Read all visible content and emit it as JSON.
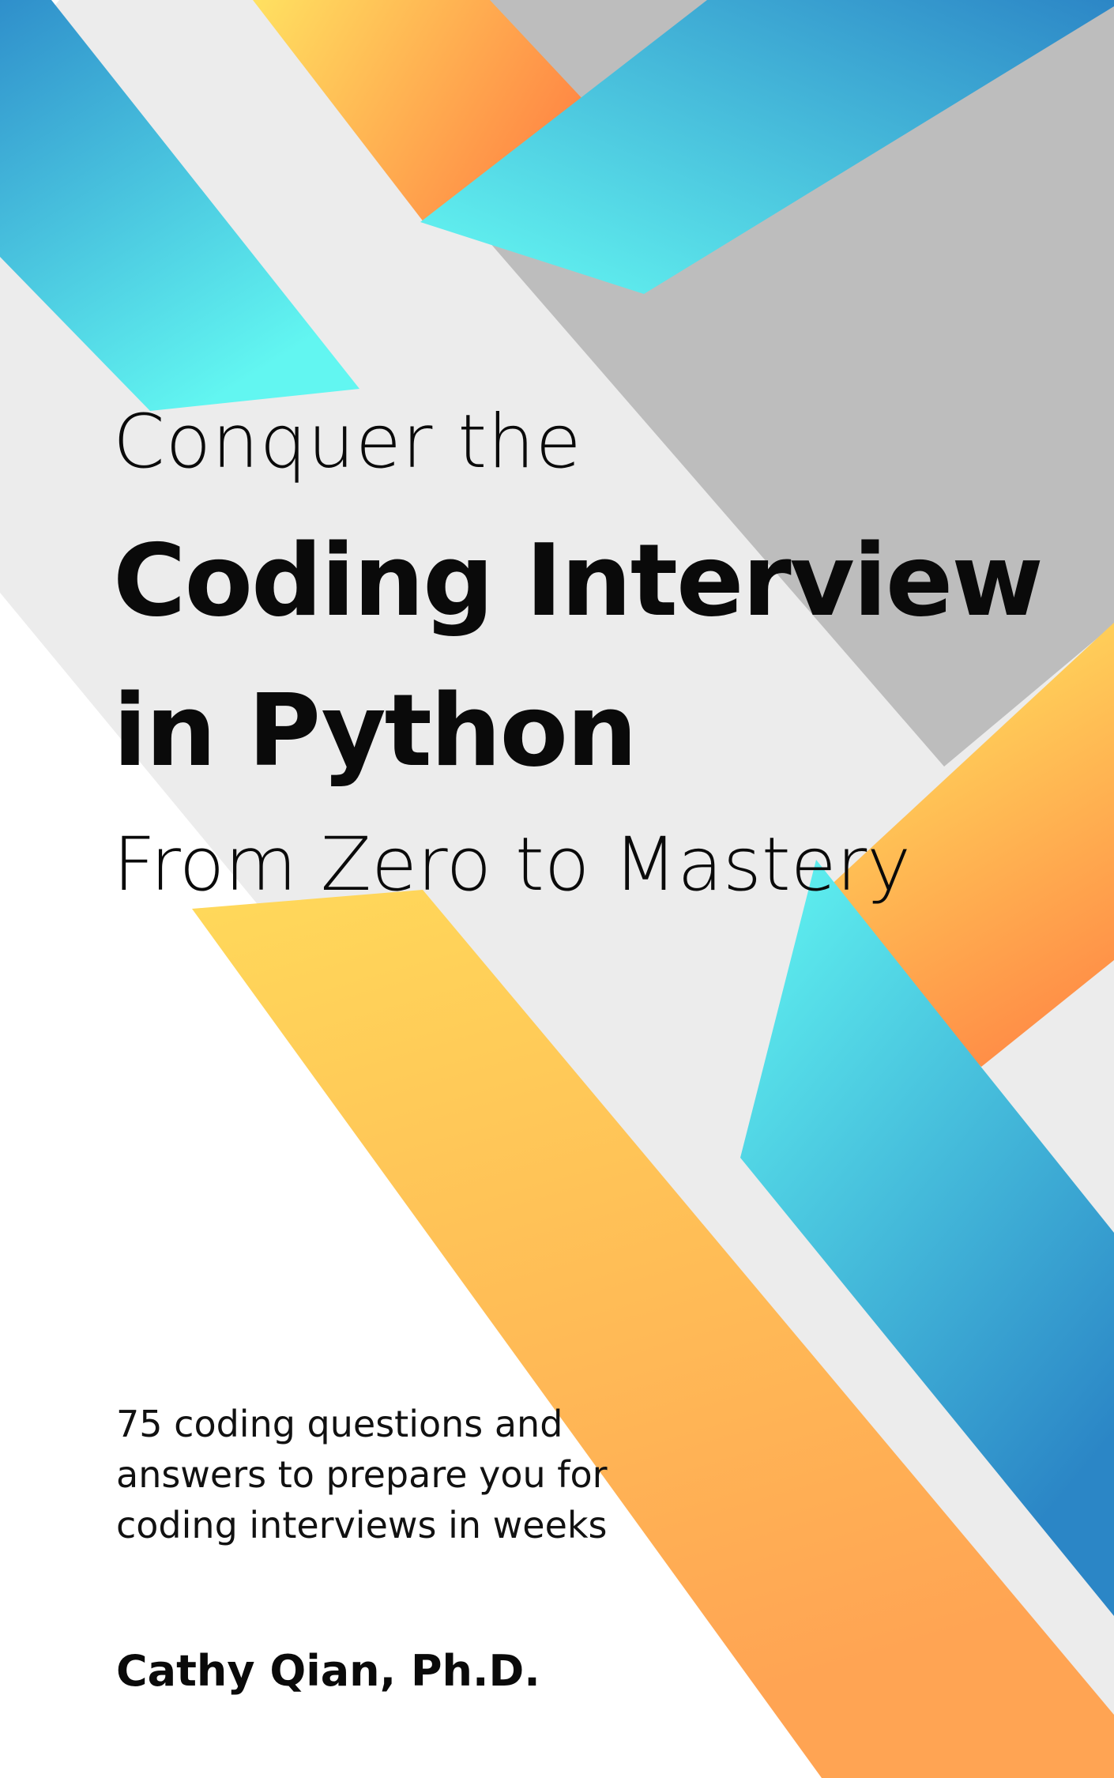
{
  "cover": {
    "pre_title": "Conquer the",
    "title_line_1": "Coding Interview",
    "title_line_2": "in Python",
    "subtitle": "From Zero to Mastery",
    "blurb_lines": [
      "75 coding questions and",
      "answers to prepare you for",
      "coding interviews in weeks"
    ],
    "author": "Cathy Qian, Ph.D."
  },
  "palette": {
    "background": "#ffffff",
    "light_gray": "#ececec",
    "mid_gray": "#bdbdbd",
    "cyan": "#5ff5f2",
    "blue": "#2a84c4",
    "yellow": "#fedd5d",
    "orange": "#fe8c48",
    "text": "#0a0a0a"
  }
}
